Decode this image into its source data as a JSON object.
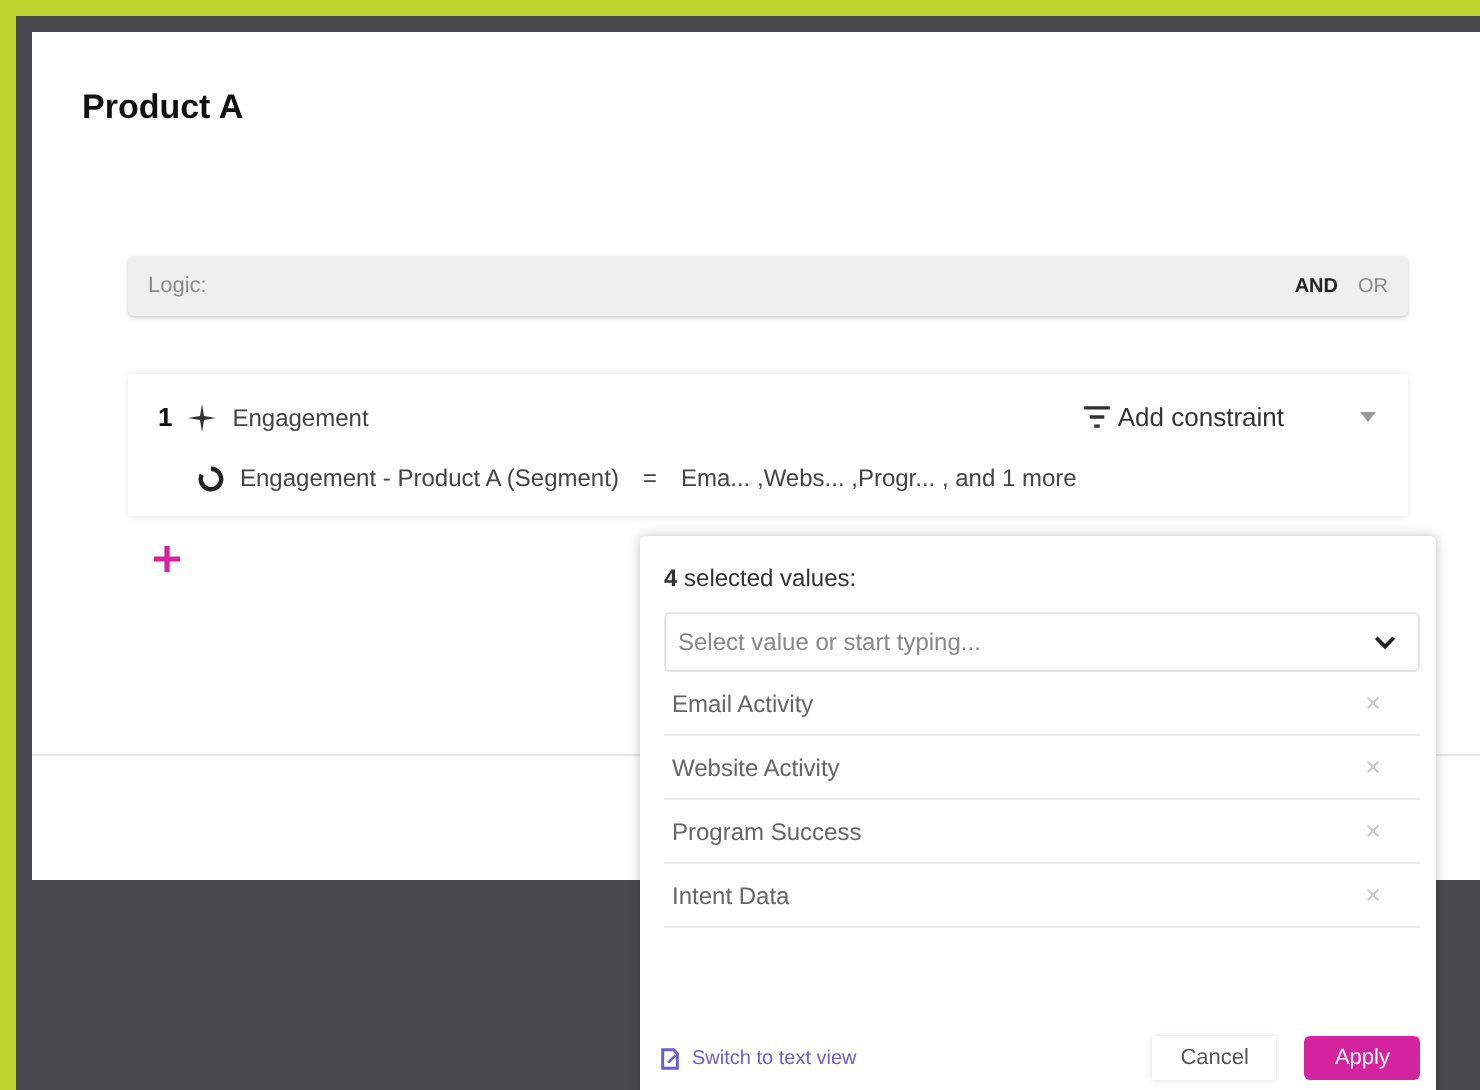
{
  "dialog": {
    "title": "Product A"
  },
  "logic": {
    "placeholder": "Logic:",
    "operators": [
      {
        "label": "AND",
        "selected": true
      },
      {
        "label": "OR",
        "selected": false
      }
    ]
  },
  "groups": [
    {
      "number": "1",
      "name": "Engagement",
      "add_constraint": "Add constraint",
      "condition": {
        "field": "Engagement - Product A (Segment)",
        "operator": "=",
        "values": "Ema... ,Webs... ,Progr... , and 1 more"
      }
    }
  ],
  "popover": {
    "heading": "**4** selected values:",
    "search": {
      "placeholder": "Select value or start typing..."
    },
    "values": [
      {
        "label": "Email Activity"
      },
      {
        "label": "Website Activity"
      },
      {
        "label": "Program Success"
      },
      {
        "label": "Intent Data"
      }
    ],
    "link": "Switch to text view",
    "cancel": "Cancel",
    "apply": "Apply"
  }
}
